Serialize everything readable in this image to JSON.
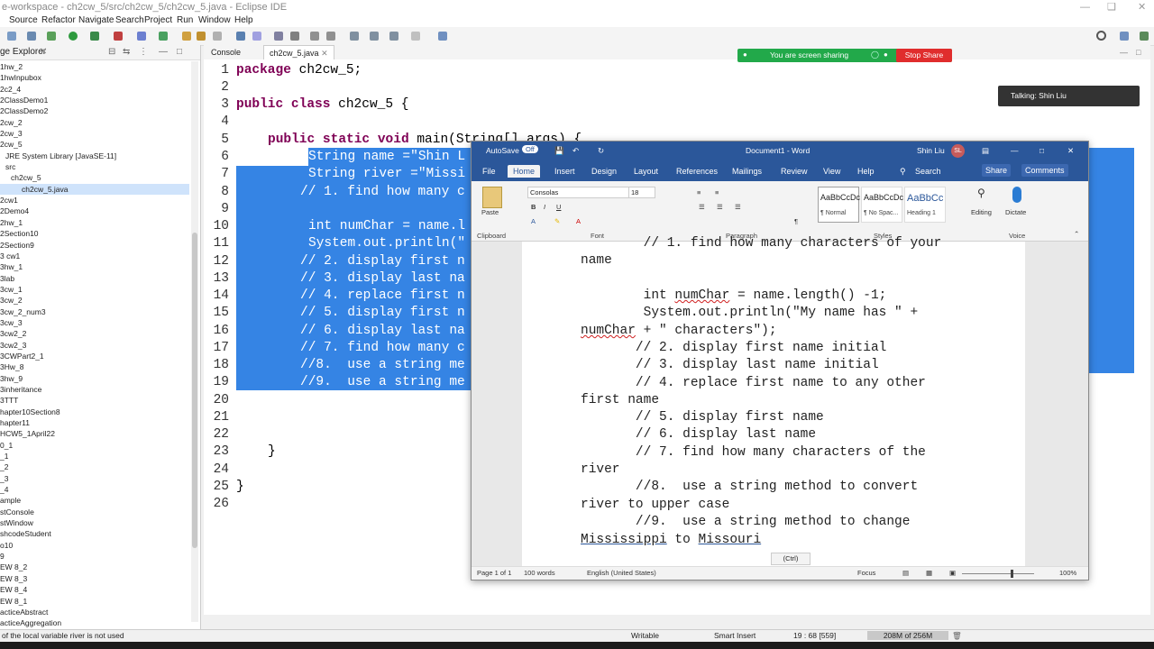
{
  "eclipse": {
    "title": "e-workspace - ch2cw_5/src/ch2cw_5/ch2cw_5.java - Eclipse IDE",
    "menu": [
      "Source",
      "Refactor",
      "Navigate",
      "Search",
      "Project",
      "Run",
      "Window",
      "Help"
    ],
    "package_explorer": {
      "title": "ge Explorer",
      "items": [
        "1hw_2",
        "1hwInpubox",
        "2c2_4",
        "2ClassDemo1",
        "2ClassDemo2",
        "2cw_2",
        "2cw_3",
        "2cw_5",
        "JRE System Library [JavaSE-11]",
        "src",
        "ch2cw_5",
        "ch2cw_5.java",
        "2cw1",
        "2Demo4",
        "2hw_1",
        "2Section10",
        "2Section9",
        "3 cw1",
        "3hw_1",
        "3lab",
        "3cw_1",
        "3cw_2",
        "3cw_2_num3",
        "3cw_3",
        "3cw2_2",
        "3cw2_3",
        "3CWPart2_1",
        "3Hw_8",
        "3hw_9",
        "3inheritance",
        "3TTT",
        "hapter10Section8",
        "hapter11",
        "HCW5_1April22",
        "0_1",
        "_1",
        "_2",
        "_3",
        "_4",
        "ample",
        "stConsole",
        "stWindow",
        "shcodeStudent",
        "o10",
        "9",
        "EW 8_2",
        "EW 8_3",
        "EW 8_4",
        "EW 8_1",
        "acticeAbstract",
        "acticeAggregation"
      ]
    },
    "tabs": [
      "Console",
      "ch2cw_5.java"
    ],
    "line_numbers": [
      "1",
      "2",
      "3",
      "4",
      "5",
      "6",
      "7",
      "8",
      "9",
      "10",
      "11",
      "12",
      "13",
      "14",
      "15",
      "16",
      "17",
      "18",
      "19",
      "20",
      "21",
      "22",
      "23",
      "24",
      "25",
      "26"
    ],
    "code": {
      "l1_kw": "package",
      "l1_rest": " ch2cw_5;",
      "l3_kw1": "public",
      "l3_kw2": "class",
      "l3_rest": " ch2cw_5 {",
      "l5_kw1": "public",
      "l5_kw2": "static",
      "l5_kw3": "void",
      "l5_rest": " main(String[] args) {",
      "l6": "String name =\"Shin L",
      "l7": "String river =\"Missi",
      "l8": "// 1. find how many c",
      "l10": "int numChar = name.l",
      "l11": "System.out.println(\"",
      "l12": "// 2. display first n",
      "l13": "// 3. display last na",
      "l14": "// 4. replace first n",
      "l15": "// 5. display first n",
      "l16": "// 6. display last na",
      "l17": "// 7. find how many c",
      "l18": "//8.  use a string me",
      "l19": "//9.  use a string me",
      "l23": "}",
      "l25": "}"
    },
    "status": {
      "warning": "of the local variable river is not used",
      "writable": "Writable",
      "insert": "Smart Insert",
      "position": "19 : 68 [559]",
      "memory": "208M of 256M"
    }
  },
  "share": {
    "banner": "You are screen sharing",
    "stop": "Stop Share",
    "talking": "Talking: Shin Liu"
  },
  "word": {
    "autosave": "AutoSave",
    "autosave_state": "Off",
    "doc_title": "Document1 - Word",
    "user": "Shin Liu",
    "user_initials": "SL",
    "tabs": [
      "File",
      "Home",
      "Insert",
      "Design",
      "Layout",
      "References",
      "Mailings",
      "Review",
      "View",
      "Help"
    ],
    "search": "Search",
    "share": "Share",
    "comments": "Comments",
    "ribbon": {
      "paste": "Paste",
      "font": "Consolas",
      "size": "18",
      "groups": [
        "Clipboard",
        "Font",
        "Paragraph",
        "Styles",
        "Voice"
      ],
      "styles": [
        {
          "sample": "AaBbCcDc",
          "name": "¶ Normal"
        },
        {
          "sample": "AaBbCcDc",
          "name": "¶ No Spac..."
        },
        {
          "sample": "AaBbCc",
          "name": "Heading 1"
        }
      ],
      "editing": "Editing",
      "dictate": "Dictate"
    },
    "doc": {
      "l1": "        // 1. find how many characters of your",
      "l2": "name",
      "l3a": "        int ",
      "l3b": "numChar",
      "l3c": " = name.length() -1;",
      "l4": "        System.out.println(\"My name has \" +",
      "l5a": "numChar",
      "l5b": " + \" characters\");",
      "l6": "       // 2. display first name initial",
      "l7": "       // 3. display last name initial",
      "l8": "       // 4. replace first name to any other",
      "l9": "first name",
      "l10": "       // 5. display first name",
      "l11": "       // 6. display last name",
      "l12": "       // 7. find how many characters of the",
      "l13": "river",
      "l14": "       //8.  use a string method to convert",
      "l15": "river to upper case",
      "l16": "       //9.  use a string method to change",
      "l17a": "Mississippi",
      "l17b": " to ",
      "l17c": "Missouri"
    },
    "ctrl": "(Ctrl)",
    "status": {
      "page": "Page 1 of 1",
      "words": "100 words",
      "lang": "English (United States)",
      "focus": "Focus",
      "zoom": "100%"
    }
  }
}
